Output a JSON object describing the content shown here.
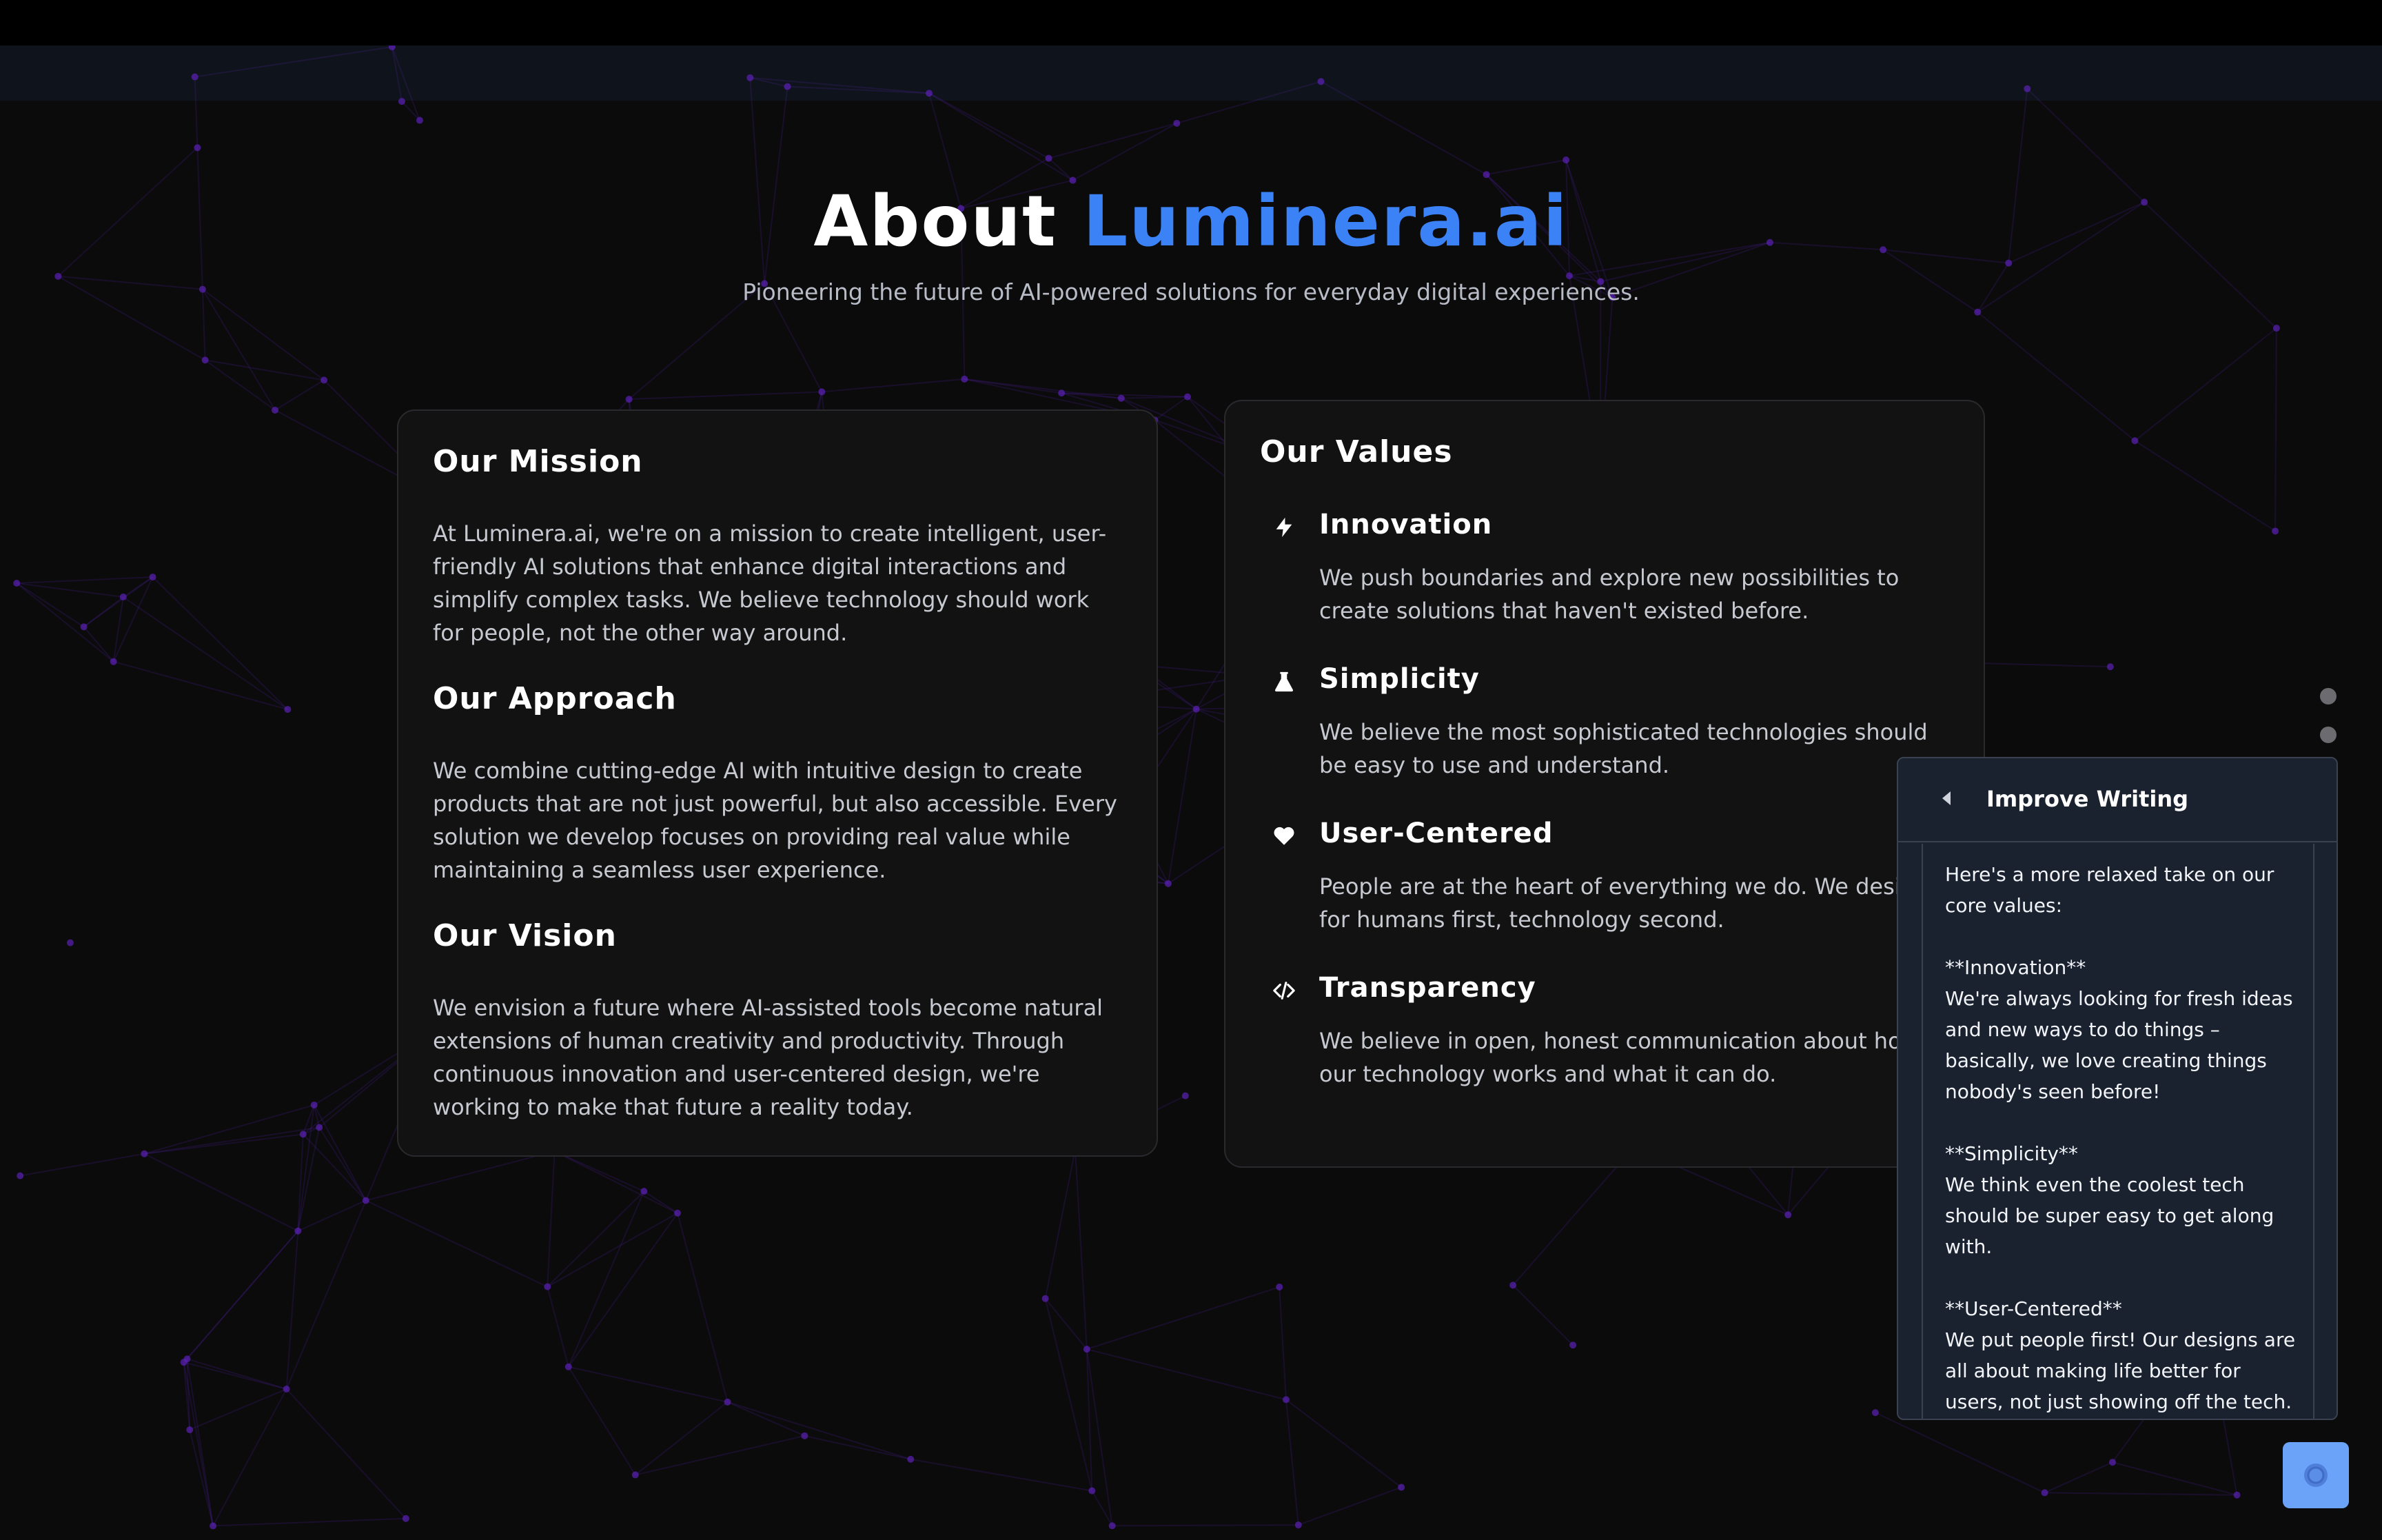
{
  "hero": {
    "title_prefix": "About ",
    "title_brand": "Luminera.ai",
    "subtitle": "Pioneering the future of AI-powered solutions for everyday digital experiences."
  },
  "mission_card": {
    "mission_title": "Our Mission",
    "mission_text": "At Luminera.ai, we're on a mission to create intelligent, user-friendly AI solutions that enhance digital interactions and simplify complex tasks. We believe technology should work for people, not the other way around.",
    "approach_title": "Our Approach",
    "approach_text": "We combine cutting-edge AI with intuitive design to create products that are not just powerful, but also accessible. Every solution we develop focuses on providing real value while maintaining a seamless user experience.",
    "vision_title": "Our Vision",
    "vision_text": "We envision a future where AI-assisted tools become natural extensions of human creativity and productivity. Through continuous innovation and user-centered design, we're working to make that future a reality today."
  },
  "values_card": {
    "title": "Our Values",
    "items": [
      {
        "icon": "bolt-icon",
        "title": "Innovation",
        "text": "We push boundaries and explore new possibilities to create solutions that haven't existed before."
      },
      {
        "icon": "flask-icon",
        "title": "Simplicity",
        "text": "We believe the most sophisticated technologies should be easy to use and understand."
      },
      {
        "icon": "heart-icon",
        "title": "User-Centered",
        "text": "People are at the heart of everything we do. We design for humans first, technology second."
      },
      {
        "icon": "code-icon",
        "title": "Transparency",
        "text": "We believe in open, honest communication about how our technology works and what it can do."
      }
    ]
  },
  "panel": {
    "title": "Improve Writing",
    "back_icon": "chevron-left-icon",
    "content": "Here's a more relaxed take on our core values:\n\n**Innovation**\nWe're always looking for fresh ideas and new ways to do things – basically, we love creating things nobody's seen before!\n\n**Simplicity**\nWe think even the coolest tech should be super easy to get along with.\n\n**User-Centered**\nWe put people first! Our designs are all about making life better for users, not just showing off the tech."
  },
  "fab": {
    "icon": "assistant-icon"
  },
  "colors": {
    "accent": "#3b82f6",
    "background": "#0b0b0c",
    "card": "#121213",
    "panel": "#1a2230",
    "network_dot": "#5b21b6"
  }
}
